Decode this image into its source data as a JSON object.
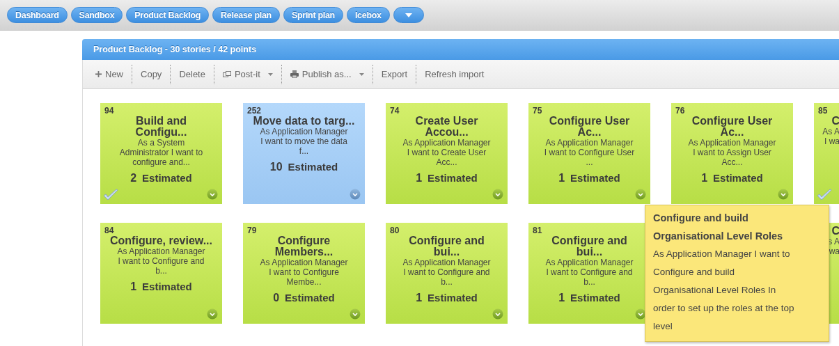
{
  "nav_tabs": [
    {
      "label": "Dashboard",
      "kind": "text"
    },
    {
      "label": "Sandbox",
      "kind": "text"
    },
    {
      "label": "Product Backlog",
      "kind": "text"
    },
    {
      "label": "Release plan",
      "kind": "text"
    },
    {
      "label": "Sprint plan",
      "kind": "text"
    },
    {
      "label": "Icebox",
      "kind": "text"
    },
    {
      "kind": "menu"
    }
  ],
  "panel": {
    "title": "Product Backlog - 30 stories / 42 points",
    "toolbar": [
      {
        "label": "New",
        "kind": "add"
      },
      {
        "label": "Copy",
        "kind": "plain"
      },
      {
        "label": "Delete",
        "kind": "plain"
      },
      {
        "label": "Post-it",
        "kind": "cardsmenu"
      },
      {
        "label": "Publish as...",
        "kind": "printmenu"
      },
      {
        "label": "Export",
        "kind": "plain"
      },
      {
        "label": "Refresh import",
        "kind": "plain"
      }
    ],
    "rows": [
      {
        "cards": [
          {
            "kind": "full",
            "number": "94",
            "title_lines": [
              "Build and",
              "Configu..."
            ],
            "description_lines": [
              "As a System",
              "Administrator I want to",
              "configure and..."
            ],
            "points": "2",
            "status": "Estimated",
            "selected": false,
            "checked": true
          },
          {
            "kind": "full",
            "number": "252",
            "title_lines": [
              "Move data to targ..."
            ],
            "description_lines": [
              "As Application Manager",
              "I want to move the data",
              "f..."
            ],
            "points": "10",
            "status": "Estimated",
            "selected": true,
            "checked": false
          },
          {
            "kind": "full",
            "number": "74",
            "title_lines": [
              "Create User",
              "Accou..."
            ],
            "description_lines": [
              "As Application Manager",
              "I want to Create User",
              "Acc..."
            ],
            "points": "1",
            "status": "Estimated",
            "selected": false,
            "checked": false
          },
          {
            "kind": "full",
            "number": "75",
            "title_lines": [
              "Configure User",
              "Ac..."
            ],
            "description_lines": [
              "As Application Manager",
              "I want to Configure User",
              "..."
            ],
            "points": "1",
            "status": "Estimated",
            "selected": false,
            "checked": false
          },
          {
            "kind": "full",
            "number": "76",
            "title_lines": [
              "Configure User",
              "Ac..."
            ],
            "description_lines": [
              "As Application Manager",
              "I want to Assign User",
              "Acc..."
            ],
            "points": "1",
            "status": "Estimated",
            "selected": false,
            "checked": false
          },
          {
            "kind": "clipped",
            "number": "85",
            "title_lines": [
              "C"
            ],
            "description_lines": [
              "As A",
              "I wa"
            ],
            "selected": false,
            "checked": true
          }
        ]
      },
      {
        "cards": [
          {
            "kind": "full",
            "number": "84",
            "title_lines": [
              "Configure, review..."
            ],
            "description_lines": [
              "As Application Manager",
              "I want to Configure and",
              "b..."
            ],
            "points": "1",
            "status": "Estimated",
            "selected": false,
            "checked": false
          },
          {
            "kind": "full",
            "number": "79",
            "title_lines": [
              "Configure",
              "Members..."
            ],
            "description_lines": [
              "As Application Manager",
              "I want to Configure",
              "Membe..."
            ],
            "points": "0",
            "status": "Estimated",
            "selected": false,
            "checked": false
          },
          {
            "kind": "full",
            "number": "80",
            "title_lines": [
              "Configure and",
              "bui..."
            ],
            "description_lines": [
              "As Application Manager",
              "I want to Configure and",
              "b..."
            ],
            "points": "1",
            "status": "Estimated",
            "selected": false,
            "checked": false
          },
          {
            "kind": "full",
            "number": "81",
            "title_lines": [
              "Configure and",
              "bui..."
            ],
            "description_lines": [
              "As Application Manager",
              "I want to Configure and",
              "b..."
            ],
            "points": "1",
            "status": "Estimated",
            "selected": false,
            "checked": false
          },
          {
            "kind": "hidden"
          },
          {
            "kind": "clipped",
            "title_lines": [
              "C"
            ],
            "description_lines": [
              "s A",
              "wa"
            ],
            "selected": false,
            "checked": false
          }
        ]
      }
    ],
    "tooltip": {
      "title": "Configure and build Organisational Level Roles",
      "text_lines": [
        "As Application Manager I want to",
        "Configure and build",
        "Organisational Level Roles In",
        "order to set up the roles at the top",
        "level"
      ]
    }
  }
}
